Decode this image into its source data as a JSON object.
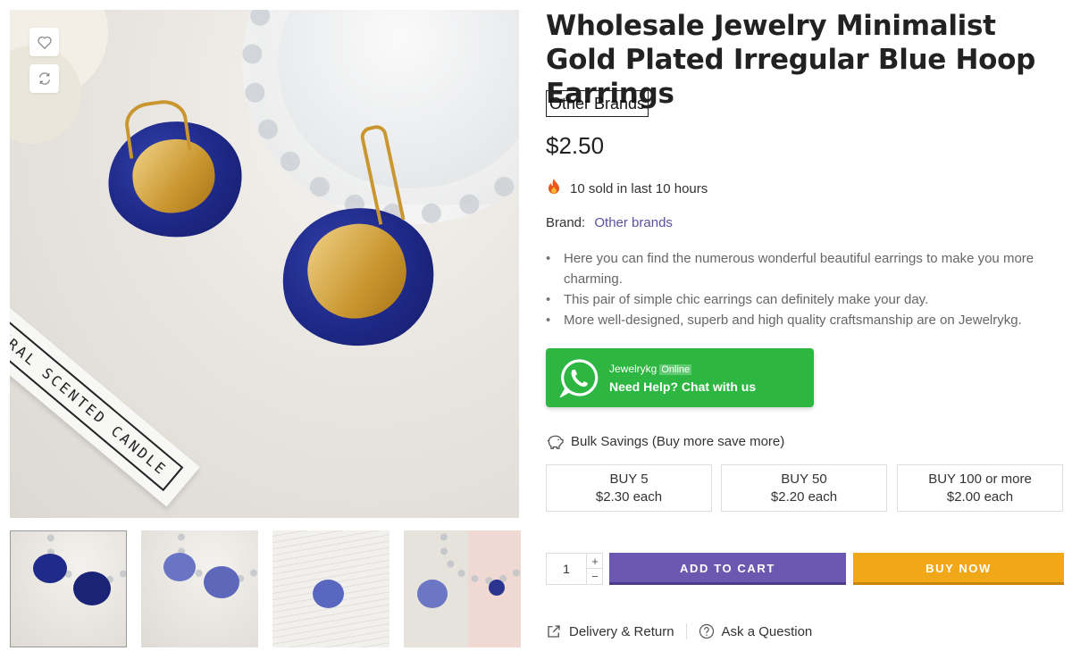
{
  "product": {
    "title": "Wholesale Jewelry Minimalist Gold Plated Irregular Blue Hoop Earrings",
    "brand_badge": "Other Brands",
    "price": "$2.50",
    "sold_text": "10 sold in last 10 hours",
    "brand_label": "Brand:",
    "brand_value": "Other brands",
    "bullets": [
      "Here you can find the numerous wonderful beautiful earrings to make you more charming.",
      "This pair of simple chic earrings can definitely make your day.",
      "More well-designed, superb and high quality craftsmanship are on Jewelrykg."
    ]
  },
  "gallery": {
    "label_text": "NATURAL SCENTED CANDLE",
    "icons": [
      "heart-icon",
      "compare-icon"
    ],
    "thumbnail_count": 4
  },
  "whatsapp": {
    "name": "Jewelrykg",
    "status": "Online",
    "help": "Need Help? Chat with us",
    "color": "#2db742"
  },
  "bulk": {
    "title": "Bulk Savings (Buy more save more)",
    "tiers": [
      {
        "qty": "BUY 5",
        "price": "$2.30 each"
      },
      {
        "qty": "BUY 50",
        "price": "$2.20 each"
      },
      {
        "qty": "BUY 100 or more",
        "price": "$2.00 each"
      }
    ]
  },
  "purchase": {
    "quantity": "1",
    "plus": "+",
    "minus": "−",
    "add_to_cart": "ADD TO CART",
    "buy_now": "BUY NOW",
    "cart_color": "#6c58b0",
    "buy_color": "#f0a818"
  },
  "links": {
    "delivery": "Delivery & Return",
    "ask": "Ask a Question"
  }
}
